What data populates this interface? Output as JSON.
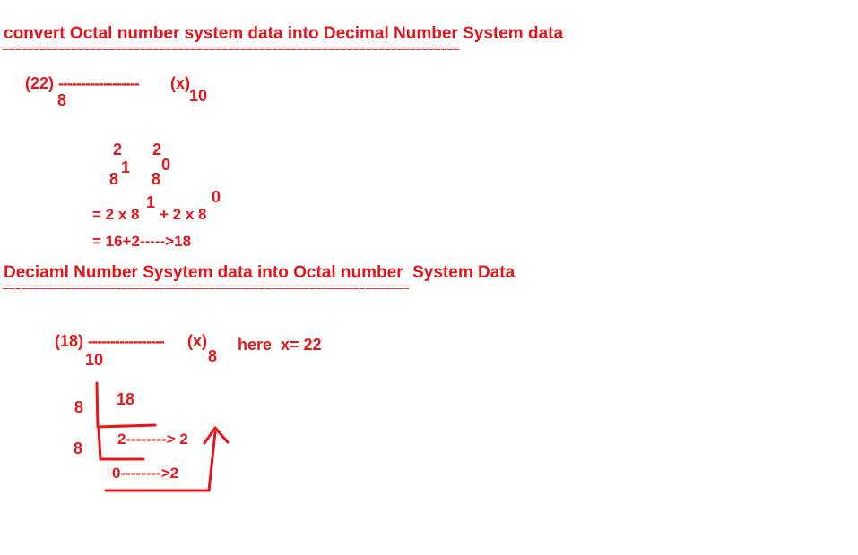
{
  "accent_color": "#e8141a",
  "section1": {
    "heading": "convert Octal number system data into Decimal Number System data",
    "rule": "=========================================================================",
    "problem": {
      "lhs": "(22)",
      "dashes": "------------------",
      "rhs": "(x)",
      "from_base": "8",
      "to_base": "10"
    },
    "digits": [
      "2",
      "2"
    ],
    "weights": [
      {
        "base": "8",
        "exp": "1"
      },
      {
        "base": "8",
        "exp": "0"
      }
    ],
    "expansion": {
      "part1": "= 2 x 8",
      "exp1": "1",
      "part2": "+ 2 x 8",
      "exp2": "0"
    },
    "result": "= 16+2----->18"
  },
  "section2": {
    "heading": "Deciaml Number Sysytem data into Octal number  System Data",
    "rule": "=================================================================",
    "problem": {
      "lhs": "(18)",
      "dashes": "-----------------",
      "rhs": "(x)",
      "from_base": "10",
      "to_base": "8"
    },
    "answer": "here  x= 22",
    "division": {
      "divisors": [
        "8",
        "8"
      ],
      "dividend": "18",
      "step1": "2--------> 2",
      "step2": "0-------->2"
    }
  }
}
